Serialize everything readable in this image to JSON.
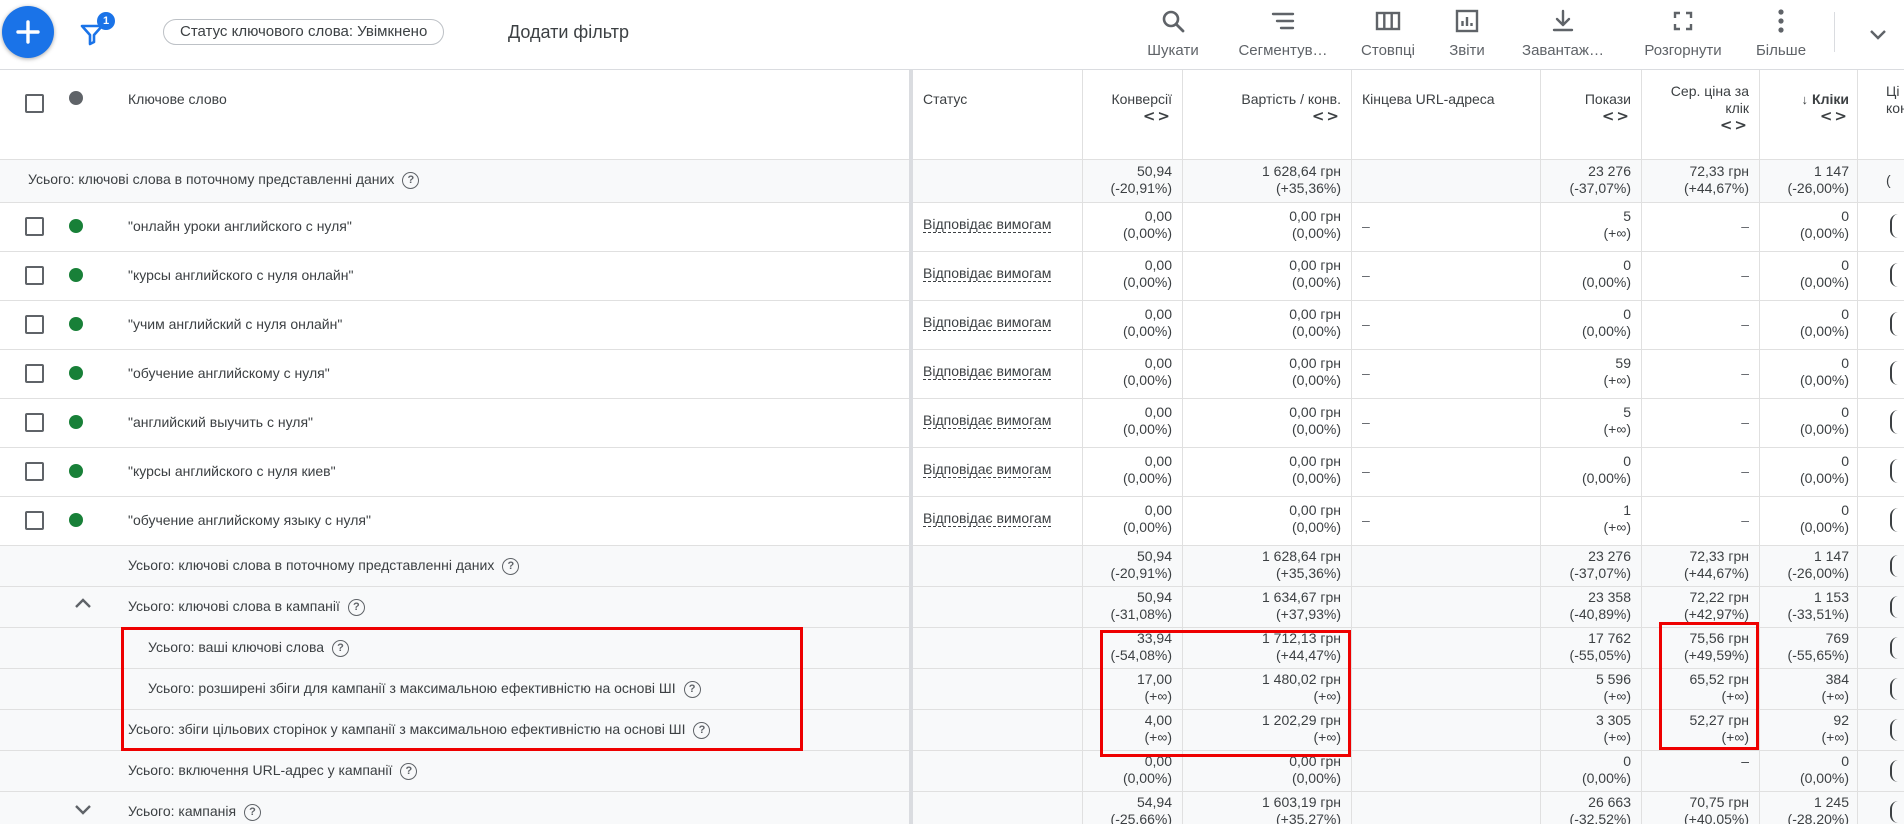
{
  "toolbar": {
    "filter_count": "1",
    "chip_label": "Статус ключового слова: Увімкнено",
    "add_filter": "Додати фільтр",
    "buttons": [
      {
        "label": "Шукати",
        "icon": "search-icon"
      },
      {
        "label": "Сегментув…",
        "icon": "segment-icon"
      },
      {
        "label": "Стовпці",
        "icon": "columns-icon"
      },
      {
        "label": "Звіти",
        "icon": "reports-icon"
      },
      {
        "label": "Завантаж…",
        "icon": "download-icon"
      },
      {
        "label": "Розгорнути",
        "icon": "expand-icon"
      },
      {
        "label": "Більше",
        "icon": "more-vertical-icon"
      }
    ]
  },
  "columns": {
    "keyword": "Ключове слово",
    "status": "Статус",
    "conversions": "Конверсії",
    "cost_per_conv": "Вартість / конв.",
    "final_url": "Кінцева URL-адреса",
    "impressions": "Покази",
    "avg_cpc_1": "Сер. ціна за",
    "avg_cpc_2": "клік",
    "clicks": "Кліки",
    "cut_1": "Ці",
    "cut_2": "кон"
  },
  "total_top": {
    "label": "Усього: ключові слова в поточному представленні даних",
    "conv": [
      "50,94",
      "(-20,91%)"
    ],
    "cpc_conv": [
      "1 628,64 грн",
      "(+35,36%)"
    ],
    "impr": [
      "23 276",
      "(-37,07%)"
    ],
    "avg_cpc": [
      "72,33 грн",
      "(+44,67%)"
    ],
    "clicks": [
      "1 147",
      "(-26,00%)"
    ],
    "cut": "("
  },
  "keyword_rows": [
    {
      "keyword": "\"онлайн уроки английского с нуля\"",
      "status": "Відповідає вимогам",
      "conv": [
        "0,00",
        "(0,00%)"
      ],
      "cpc_conv": [
        "0,00 грн",
        "(0,00%)"
      ],
      "url": "–",
      "impr": [
        "5",
        "(+∞)"
      ],
      "avg_cpc": "–",
      "clicks": [
        "0",
        "(0,00%)"
      ]
    },
    {
      "keyword": "\"курсы английского с нуля онлайн\"",
      "status": "Відповідає вимогам",
      "conv": [
        "0,00",
        "(0,00%)"
      ],
      "cpc_conv": [
        "0,00 грн",
        "(0,00%)"
      ],
      "url": "–",
      "impr": [
        "0",
        "(0,00%)"
      ],
      "avg_cpc": "–",
      "clicks": [
        "0",
        "(0,00%)"
      ]
    },
    {
      "keyword": "\"учим английский с нуля онлайн\"",
      "status": "Відповідає вимогам",
      "conv": [
        "0,00",
        "(0,00%)"
      ],
      "cpc_conv": [
        "0,00 грн",
        "(0,00%)"
      ],
      "url": "–",
      "impr": [
        "0",
        "(0,00%)"
      ],
      "avg_cpc": "–",
      "clicks": [
        "0",
        "(0,00%)"
      ]
    },
    {
      "keyword": "\"обучение английскому с нуля\"",
      "status": "Відповідає вимогам",
      "conv": [
        "0,00",
        "(0,00%)"
      ],
      "cpc_conv": [
        "0,00 грн",
        "(0,00%)"
      ],
      "url": "–",
      "impr": [
        "59",
        "(+∞)"
      ],
      "avg_cpc": "–",
      "clicks": [
        "0",
        "(0,00%)"
      ]
    },
    {
      "keyword": "\"английский выучить с нуля\"",
      "status": "Відповідає вимогам",
      "conv": [
        "0,00",
        "(0,00%)"
      ],
      "cpc_conv": [
        "0,00 грн",
        "(0,00%)"
      ],
      "url": "–",
      "impr": [
        "5",
        "(+∞)"
      ],
      "avg_cpc": "–",
      "clicks": [
        "0",
        "(0,00%)"
      ]
    },
    {
      "keyword": "\"курсы английского с нуля киев\"",
      "status": "Відповідає вимогам",
      "conv": [
        "0,00",
        "(0,00%)"
      ],
      "cpc_conv": [
        "0,00 грн",
        "(0,00%)"
      ],
      "url": "–",
      "impr": [
        "0",
        "(0,00%)"
      ],
      "avg_cpc": "–",
      "clicks": [
        "0",
        "(0,00%)"
      ]
    },
    {
      "keyword": "\"обучение английскому языку с нуля\"",
      "status": "Відповідає вимогам",
      "conv": [
        "0,00",
        "(0,00%)"
      ],
      "cpc_conv": [
        "0,00 грн",
        "(0,00%)"
      ],
      "url": "–",
      "impr": [
        "1",
        "(+∞)"
      ],
      "avg_cpc": "–",
      "clicks": [
        "0",
        "(0,00%)"
      ]
    }
  ],
  "total_rows": [
    {
      "label": "Усього: ключові слова в поточному представленні даних",
      "conv": [
        "50,94",
        "(-20,91%)"
      ],
      "cpc_conv": [
        "1 628,64 грн",
        "(+35,36%)"
      ],
      "impr": [
        "23 276",
        "(-37,07%)"
      ],
      "avg_cpc": [
        "72,33 грн",
        "(+44,67%)"
      ],
      "clicks": [
        "1 147",
        "(-26,00%)"
      ]
    },
    {
      "label": "Усього: ключові слова в кампанії",
      "conv": [
        "50,94",
        "(-31,08%)"
      ],
      "cpc_conv": [
        "1 634,67 грн",
        "(+37,93%)"
      ],
      "impr": [
        "23 358",
        "(-40,89%)"
      ],
      "avg_cpc": [
        "72,22 грн",
        "(+42,97%)"
      ],
      "clicks": [
        "1 153",
        "(-33,51%)"
      ]
    },
    {
      "label": "Усього: ваші ключові слова",
      "conv": [
        "33,94",
        "(-54,08%)"
      ],
      "cpc_conv": [
        "1 712,13 грн",
        "(+44,47%)"
      ],
      "impr": [
        "17 762",
        "(-55,05%)"
      ],
      "avg_cpc": [
        "75,56 грн",
        "(+49,59%)"
      ],
      "clicks": [
        "769",
        "(-55,65%)"
      ]
    },
    {
      "label": "Усього: розширені збіги для кампанії з максимальною ефективністю на основі ШІ",
      "conv": [
        "17,00",
        "(+∞)"
      ],
      "cpc_conv": [
        "1 480,02 грн",
        "(+∞)"
      ],
      "impr": [
        "5 596",
        "(+∞)"
      ],
      "avg_cpc": [
        "65,52 грн",
        "(+∞)"
      ],
      "clicks": [
        "384",
        "(+∞)"
      ]
    },
    {
      "label": "Усього: збіги цільових сторінок у кампанії з максимальною ефективністю на основі ШІ",
      "conv": [
        "4,00",
        "(+∞)"
      ],
      "cpc_conv": [
        "1 202,29 грн",
        "(+∞)"
      ],
      "impr": [
        "3 305",
        "(+∞)"
      ],
      "avg_cpc": [
        "52,27 грн",
        "(+∞)"
      ],
      "clicks": [
        "92",
        "(+∞)"
      ]
    },
    {
      "label": "Усього: включення URL-адрес у кампанії",
      "conv": [
        "0,00",
        "(0,00%)"
      ],
      "cpc_conv": [
        "0,00 грн",
        "(0,00%)"
      ],
      "impr": [
        "0",
        "(0,00%)"
      ],
      "avg_cpc": [
        "–",
        ""
      ],
      "clicks": [
        "0",
        "(0,00%)"
      ]
    },
    {
      "label": "Усього: кампанія",
      "conv": [
        "54,94",
        "(-25,66%)"
      ],
      "cpc_conv": [
        "1 603,19 грн",
        "(+35,27%)"
      ],
      "impr": [
        "26 663",
        "(-32,52%)"
      ],
      "avg_cpc": [
        "70,75 грн",
        "(+40,05%)"
      ],
      "clicks": [
        "1 245",
        "(-28,20%)"
      ]
    }
  ],
  "colors": {
    "accent": "#1a73e8",
    "status_dot": "#188038",
    "highlight": "#e00000"
  }
}
